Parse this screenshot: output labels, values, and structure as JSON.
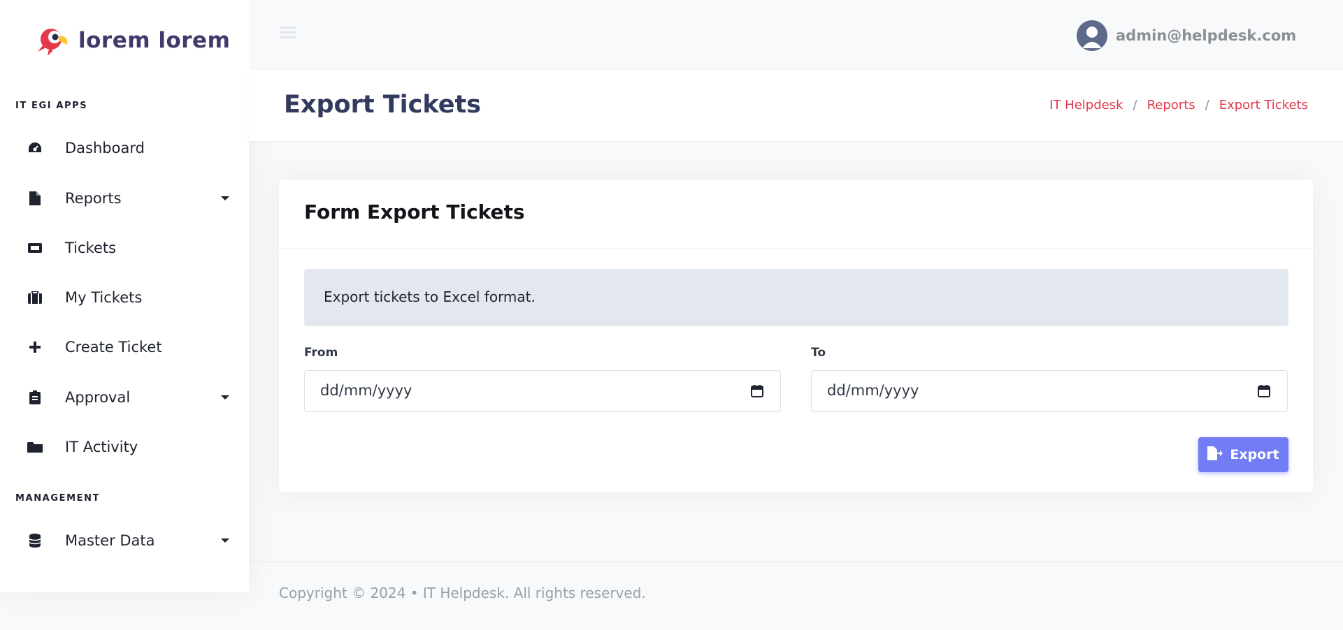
{
  "brand": {
    "name": "lorem lorem",
    "logo_icon": "parrot-logo"
  },
  "sidebar": {
    "sections": [
      {
        "title": "IT EGI APPS"
      },
      {
        "title": "MANAGEMENT"
      }
    ],
    "items": [
      {
        "label": "Dashboard",
        "icon": "dashboard-icon"
      },
      {
        "label": "Reports",
        "icon": "file-icon"
      },
      {
        "label": "Tickets",
        "icon": "ticket-icon"
      },
      {
        "label": "My Tickets",
        "icon": "suitcase-icon"
      },
      {
        "label": "Create Ticket",
        "icon": "plus-icon"
      },
      {
        "label": "Approval",
        "icon": "clipboard-icon"
      },
      {
        "label": "IT Activity",
        "icon": "folder-icon"
      },
      {
        "label": "Master Data",
        "icon": "database-icon"
      }
    ]
  },
  "topbar": {
    "user_email": "admin@helpdesk.com"
  },
  "page": {
    "title": "Export Tickets",
    "breadcrumb": [
      "IT Helpdesk",
      "Reports",
      "Export Tickets"
    ],
    "breadcrumb_sep": "/"
  },
  "form": {
    "card_title": "Form Export Tickets",
    "alert": "Export tickets to Excel format.",
    "from_label": "From",
    "to_label": "To",
    "from_placeholder": "dd/mm/yyyy",
    "to_placeholder": "dd/mm/yyyy",
    "export_label": "Export"
  },
  "footer": {
    "text": "Copyright © 2024  •  IT Helpdesk. All rights reserved."
  },
  "colors": {
    "accent": "#727cf5",
    "danger": "#e5384a",
    "title": "#323a5e"
  }
}
